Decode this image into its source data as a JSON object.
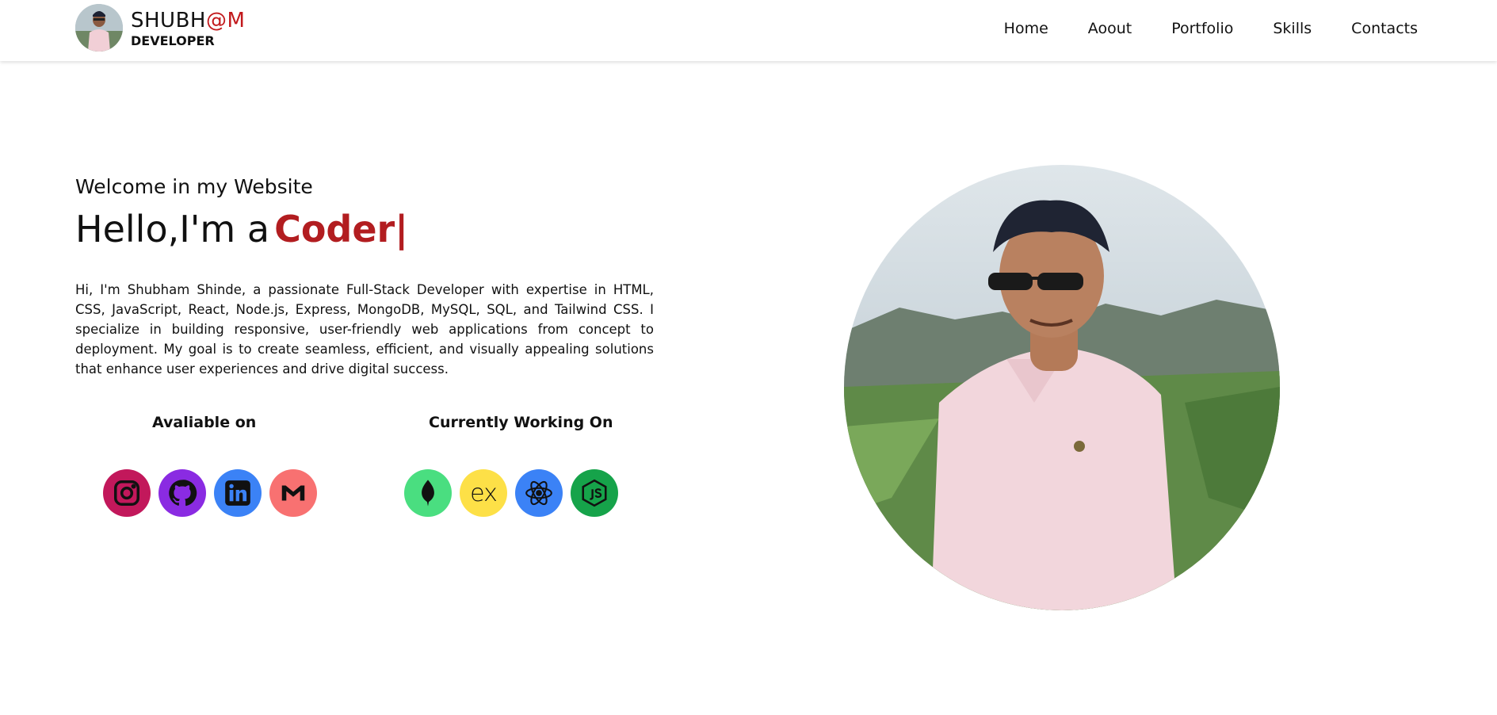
{
  "header": {
    "brand_name": "SHUBH",
    "brand_accent": "@M",
    "brand_sub": "DEVELOPER",
    "nav": [
      "Home",
      "Aoout",
      "Portfolio",
      "Skills",
      "Contacts"
    ]
  },
  "hero": {
    "welcome": "Welcome in my Website",
    "greeting": "Hello,I'm a",
    "role": "Coder",
    "cursor": "|",
    "bio": "Hi, I'm Shubham Shinde, a passionate Full-Stack Developer with expertise in HTML, CSS, JavaScript, React, Node.js, Express, MongoDB, MySQL, SQL, and Tailwind CSS. I specialize in building responsive, user-friendly web applications from concept to deployment. My goal is to create seamless, efficient, and visually appealing solutions that enhance user experiences and drive digital success."
  },
  "available": {
    "title": "Avaliable on",
    "icons": [
      {
        "name": "instagram-icon",
        "color": "#c2185b"
      },
      {
        "name": "github-icon",
        "color": "#8a2be2"
      },
      {
        "name": "linkedin-icon",
        "color": "#3b82f6"
      },
      {
        "name": "gmail-icon",
        "color": "#f87171"
      }
    ]
  },
  "working": {
    "title": "Currently Working On",
    "icons": [
      {
        "name": "mongodb-icon",
        "color": "#4ade80",
        "glyph": ""
      },
      {
        "name": "express-icon",
        "color": "#fde047",
        "glyph": "ex"
      },
      {
        "name": "react-icon",
        "color": "#3b82f6",
        "glyph": ""
      },
      {
        "name": "nodejs-icon",
        "color": "#16a34a",
        "glyph": ""
      }
    ]
  },
  "colors": {
    "accent": "#b21d20",
    "text": "#111111"
  }
}
